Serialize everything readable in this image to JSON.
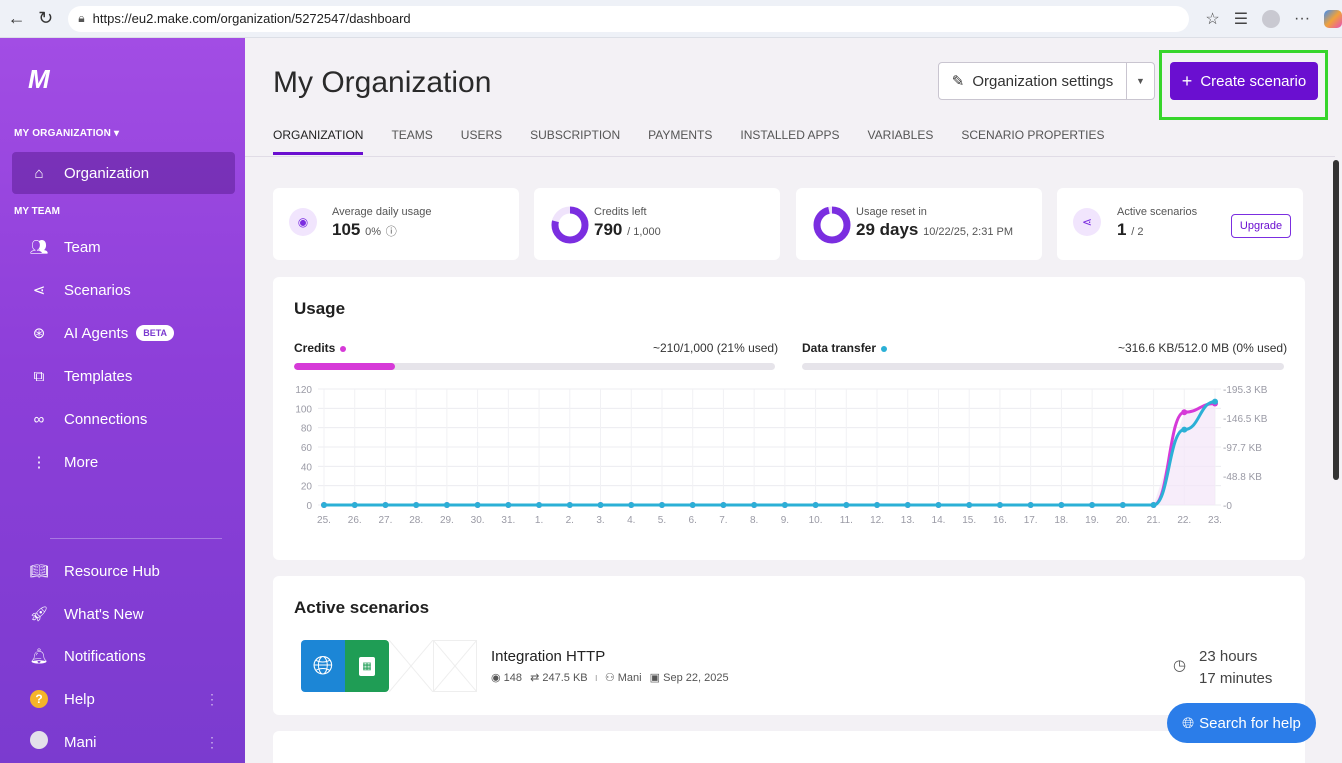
{
  "browser": {
    "url": "https://eu2.make.com/organization/5272547/dashboard"
  },
  "sidebar": {
    "logo": "M",
    "org_label": "MY ORGANIZATION ▾",
    "org_item": "Organization",
    "team_label": "MY TEAM",
    "items": [
      {
        "label": "Team",
        "icon": "team-icon"
      },
      {
        "label": "Scenarios",
        "icon": "share-icon"
      },
      {
        "label": "AI Agents",
        "icon": "ai-agent-icon",
        "badge": "BETA"
      },
      {
        "label": "Templates",
        "icon": "puzzle-icon"
      },
      {
        "label": "Connections",
        "icon": "link-icon"
      },
      {
        "label": "More",
        "icon": "more-icon"
      }
    ],
    "bottom_items": [
      {
        "label": "Resource Hub",
        "icon": "book-icon"
      },
      {
        "label": "What's New",
        "icon": "rocket-icon"
      },
      {
        "label": "Notifications",
        "icon": "bell-icon"
      },
      {
        "label": "Help",
        "icon": "help-icon"
      },
      {
        "label": "Mani",
        "icon": "avatar"
      }
    ]
  },
  "header": {
    "title": "My Organization",
    "settings_label": "Organization settings",
    "create_label": "Create scenario"
  },
  "tabs": [
    "ORGANIZATION",
    "TEAMS",
    "USERS",
    "SUBSCRIPTION",
    "PAYMENTS",
    "INSTALLED APPS",
    "VARIABLES",
    "SCENARIO PROPERTIES"
  ],
  "stats": {
    "avg_label": "Average daily usage",
    "avg_value": "105",
    "avg_pct": "0%",
    "credits_label": "Credits left",
    "credits_value": "790",
    "credits_total": "/ 1,000",
    "reset_label": "Usage reset in",
    "reset_value": "29 days",
    "reset_date": "10/22/25, 2:31 PM",
    "active_label": "Active scenarios",
    "active_value": "1",
    "active_total": "/ 2",
    "upgrade_label": "Upgrade"
  },
  "usage": {
    "title": "Usage",
    "credits_label": "Credits",
    "credits_value": "~210/1,000 (21% used)",
    "credits_fraction": 0.21,
    "transfer_label": "Data transfer",
    "transfer_value": "~316.6 KB/512.0 MB (0% used)",
    "transfer_fraction": 0.0
  },
  "chart_data": {
    "type": "line",
    "x": [
      "25.",
      "26.",
      "27.",
      "28.",
      "29.",
      "30.",
      "31.",
      "1.",
      "2.",
      "3.",
      "4.",
      "5.",
      "6.",
      "7.",
      "8.",
      "9.",
      "10.",
      "11.",
      "12.",
      "13.",
      "14.",
      "15.",
      "16.",
      "17.",
      "18.",
      "19.",
      "20.",
      "21.",
      "22.",
      "23."
    ],
    "yticks_left": [
      "0",
      "20",
      "40",
      "60",
      "80",
      "100",
      "120"
    ],
    "ylim_left": [
      0,
      120
    ],
    "yticks_right": [
      "0",
      "48.8 KB",
      "97.7 KB",
      "146.5 KB",
      "195.3 KB"
    ],
    "series": [
      {
        "name": "Credits",
        "color": "#d63ad8",
        "values": [
          0,
          0,
          0,
          0,
          0,
          0,
          0,
          0,
          0,
          0,
          0,
          0,
          0,
          0,
          0,
          0,
          0,
          0,
          0,
          0,
          0,
          0,
          0,
          0,
          0,
          0,
          0,
          0,
          96,
          105
        ]
      },
      {
        "name": "Data transfer",
        "color": "#2bb0d6",
        "values": [
          0,
          0,
          0,
          0,
          0,
          0,
          0,
          0,
          0,
          0,
          0,
          0,
          0,
          0,
          0,
          0,
          0,
          0,
          0,
          0,
          0,
          0,
          0,
          0,
          0,
          0,
          0,
          0,
          78,
          107
        ]
      }
    ],
    "grid": true
  },
  "scenarios": {
    "title": "Active scenarios",
    "items": [
      {
        "name": "Integration HTTP",
        "ops": "148",
        "transfer": "247.5 KB",
        "owner": "Mani",
        "date": "Sep 22, 2025",
        "time_line1": "23 hours",
        "time_line2": "17 minutes"
      }
    ]
  },
  "help_button": "Search for help",
  "colors": {
    "accent": "#6a0fd0",
    "sidebar": "#8d3fd9",
    "credits": "#d63ad8",
    "transfer": "#2bb0d6",
    "highlight": "#36d52b"
  }
}
